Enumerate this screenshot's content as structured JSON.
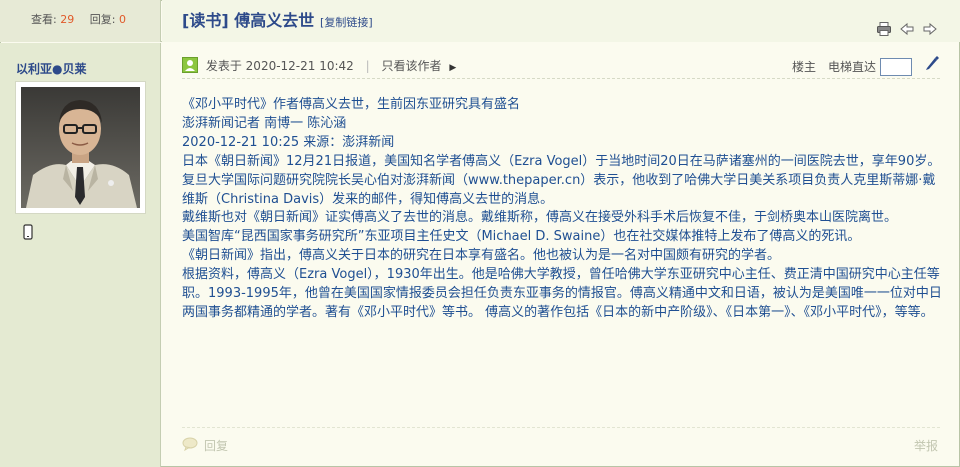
{
  "stats": {
    "views_label": "查看:",
    "views": "29",
    "replies_label": "回复:",
    "replies": "0"
  },
  "thread": {
    "title": "[读书] 傅高义去世",
    "copy_link": "[复制链接]"
  },
  "author": {
    "name": "以利亚●贝莱"
  },
  "post": {
    "posted_label": "发表于",
    "posted_time": "2020-12-21 10:42",
    "only_author": "只看该作者",
    "floor_label": "楼主",
    "elevator_label": "电梯直达",
    "reply_label": "回复",
    "report_label": "举报",
    "paragraphs": [
      "《邓小平时代》作者傅高义去世，生前因东亚研究具有盛名",
      "澎湃新闻记者 南博一 陈沁涵",
      "2020-12-21 10:25  来源：澎湃新闻",
      "日本《朝日新闻》12月21日报道，美国知名学者傅高义（Ezra Vogel）于当地时间20日在马萨诸塞州的一间医院去世，享年90岁。",
      "复旦大学国际问题研究院院长吴心伯对澎湃新闻（www.thepaper.cn）表示，他收到了哈佛大学日美关系项目负责人克里斯蒂娜·戴维斯（Christina Davis）发来的邮件，得知傅高义去世的消息。",
      "戴维斯也对《朝日新闻》证实傅高义了去世的消息。戴维斯称，傅高义在接受外科手术后恢复不佳，于剑桥奥本山医院离世。",
      "美国智库“昆西国家事务研究所”东亚项目主任史文（Michael D. Swaine）也在社交媒体推特上发布了傅高义的死讯。",
      "《朝日新闻》指出，傅高义关于日本的研究在日本享有盛名。他也被认为是一名对中国颇有研究的学者。",
      "根据资料，傅高义（Ezra Vogel），1930年出生。他是哈佛大学教授，曾任哈佛大学东亚研究中心主任、费正清中国研究中心主任等职。1993-1995年，他曾在美国国家情报委员会担任负责东亚事务的情报官。傅高义精通中文和日语，被认为是美国唯一一位对中日两国事务都精通的学者。著有《邓小平时代》等书。 傅高义的著作包括《日本的新中产阶级》、《日本第一》、《邓小平时代》，等等。"
    ]
  },
  "icons": {
    "print": "print-icon",
    "prev": "arrow-left-icon",
    "next": "arrow-right-icon",
    "online": "online-status-icon",
    "phone": "mobile-phone-icon",
    "pen": "pen-icon",
    "reply": "reply-bubble-icon"
  },
  "colors": {
    "link_blue": "#2d4a8a",
    "content_blue": "#1f4f92",
    "count_orange": "#e05a2a",
    "sidebar_bg": "#e4ead2"
  }
}
